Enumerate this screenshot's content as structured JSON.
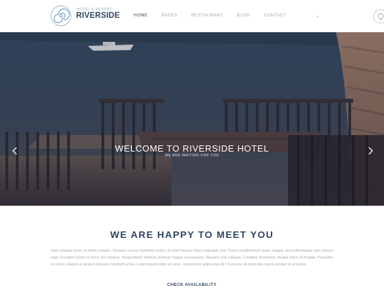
{
  "header": {
    "logo_tagline": "HOTEL & RESORT",
    "logo_name": "RIVERSIDE",
    "nav": [
      {
        "label": "HOME",
        "active": true
      },
      {
        "label": "PAGES",
        "active": false
      },
      {
        "label": "RESTAURANT",
        "active": false
      },
      {
        "label": "BLOG",
        "active": false
      },
      {
        "label": "CONTACT",
        "active": false
      }
    ],
    "lang_icon": "chat-bubble-icon"
  },
  "hero": {
    "title": "WELCOME TO RIVERSIDE HOTEL",
    "subtitle": "WE ARE WAITING FOR YOU",
    "prev_icon": "chevron-left-icon",
    "next_icon": "chevron-right-icon"
  },
  "intro": {
    "title": "WE ARE HAPPY TO MEET YOU",
    "body": "Nam volutpat lorem at mollis sodales. Quisque cursus imperdiet metus, sit amet tempus libero vulputate sed. Fusce condimentum quam magna, sed pellentesque sem ultrices eget. Curabitur luctus in lacus non tempus. Suspendisse rhoncus pulvinar magna sed posuere. Aliquam erat volutpat. Curabitur fermentum feugiat libero et fringilla. Phasellus ex lorem, lobortis at laoreet placerat, hendrerit at leo. Lorem ipsum dolor sit amet, consectetur adipiscing elit. Ut at urna sit amet felis varius semper id ut metus.",
    "button": "CHECK AVAILABILITY"
  },
  "colors": {
    "brand": "#2f4660",
    "muted": "#9aa6b3"
  }
}
